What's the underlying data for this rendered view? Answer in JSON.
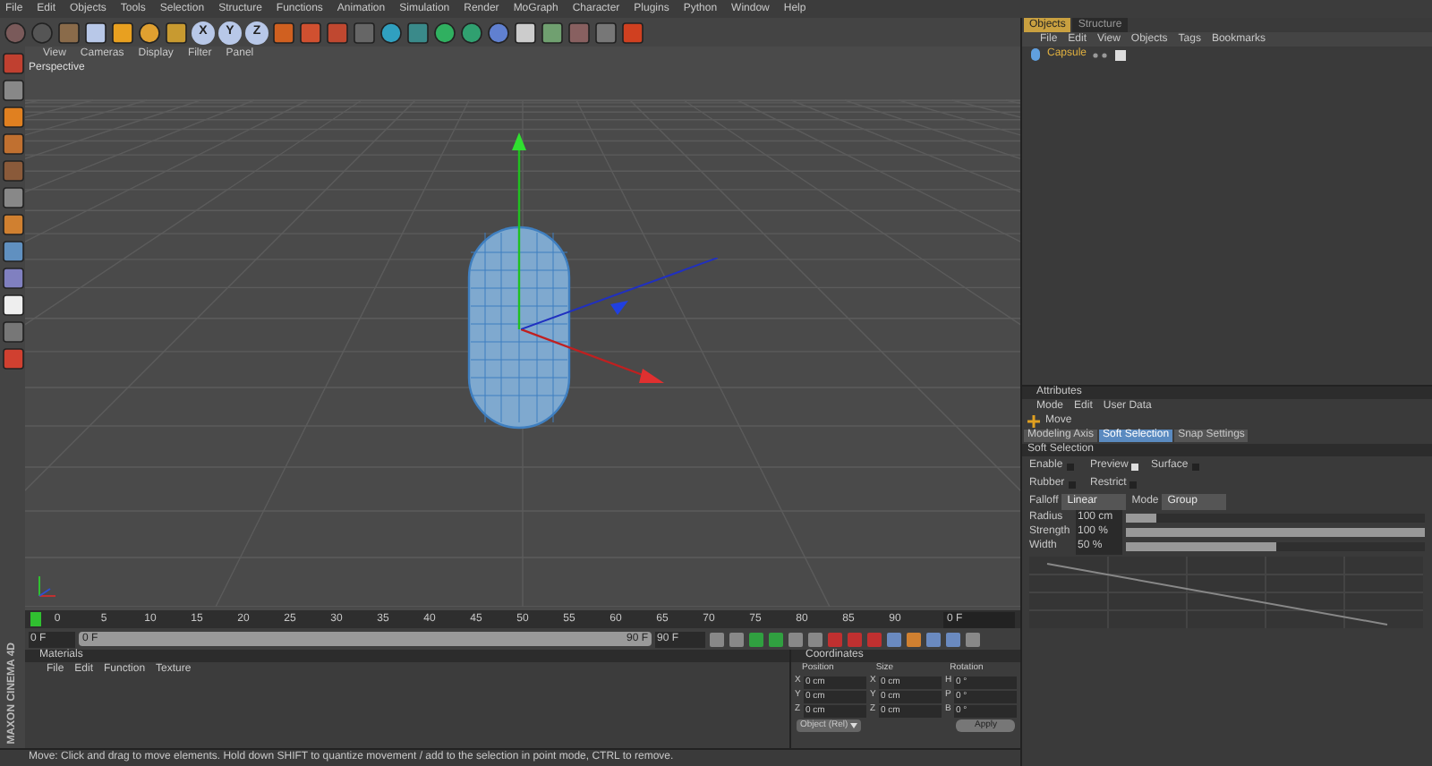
{
  "menu_bar": [
    "File",
    "Edit",
    "Objects",
    "Tools",
    "Selection",
    "Structure",
    "Functions",
    "Animation",
    "Simulation",
    "Render",
    "MoGraph",
    "Character",
    "Plugins",
    "Python",
    "Window",
    "Help"
  ],
  "toolbar": {
    "axis_buttons": [
      {
        "label": "X",
        "selected": true
      },
      {
        "label": "Y",
        "selected": true
      },
      {
        "label": "Z",
        "selected": true
      }
    ]
  },
  "viewport": {
    "menu": [
      "View",
      "Cameras",
      "Display",
      "Filter",
      "Panel"
    ],
    "camera_label": "Perspective"
  },
  "objects_panel": {
    "tabs": [
      {
        "label": "Objects",
        "selected": true
      },
      {
        "label": "Structure",
        "selected": false
      }
    ],
    "menu": [
      "File",
      "Edit",
      "View",
      "Objects",
      "Tags",
      "Bookmarks"
    ],
    "objects": [
      {
        "name": "Capsule",
        "selected": false
      }
    ]
  },
  "attributes_panel": {
    "title": "Attributes",
    "menu": [
      "Mode",
      "Edit",
      "User Data"
    ],
    "tool_name": "Move",
    "tabs": [
      {
        "label": "Modeling Axis",
        "selected": false
      },
      {
        "label": "Soft Selection",
        "selected": true
      },
      {
        "label": "Snap Settings",
        "selected": false
      }
    ],
    "section": "Soft Selection",
    "checkboxes": [
      {
        "label": "Enable",
        "checked": false
      },
      {
        "label": "Preview",
        "checked": true
      },
      {
        "label": "Surface",
        "checked": false
      },
      {
        "label": "Rubber",
        "checked": false
      },
      {
        "label": "Restrict",
        "checked": false
      }
    ],
    "dropdowns": [
      {
        "label": "Falloff",
        "value": "Linear"
      },
      {
        "label": "Mode",
        "value": "Group"
      }
    ],
    "sliders": [
      {
        "label": "Radius",
        "value": "100 cm",
        "level": 0.1
      },
      {
        "label": "Strength",
        "value": "100 %",
        "level": 1
      },
      {
        "label": "Width",
        "value": "50 %",
        "level": 0.5
      }
    ]
  },
  "timeline": {
    "ticks": [
      "0",
      "5",
      "10",
      "15",
      "20",
      "25",
      "30",
      "35",
      "40",
      "45",
      "50",
      "55",
      "60",
      "65",
      "70",
      "75",
      "80",
      "85",
      "90"
    ],
    "current_frame": "0 F",
    "playhead": {
      "level": 0
    },
    "range": {
      "level": 1
    },
    "start_field": "0 F",
    "range_start": "0 F",
    "range_end": "90 F",
    "end_field": "90 F"
  },
  "materials_panel": {
    "title": "Materials",
    "menu": [
      "File",
      "Edit",
      "Function",
      "Texture"
    ]
  },
  "coordinates_panel": {
    "title": "Coordinates",
    "columns": [
      "Position",
      "Size",
      "Rotation"
    ],
    "rows": [
      [
        {
          "axis": "X",
          "value": "0 cm"
        },
        {
          "axis": "X",
          "value": "0 cm"
        },
        {
          "axis": "H",
          "value": "0 °"
        }
      ],
      [
        {
          "axis": "Y",
          "value": "0 cm"
        },
        {
          "axis": "Y",
          "value": "0 cm"
        },
        {
          "axis": "P",
          "value": "0 °"
        }
      ],
      [
        {
          "axis": "Z",
          "value": "0 cm"
        },
        {
          "axis": "Z",
          "value": "0 cm"
        },
        {
          "axis": "B",
          "value": "0 °"
        }
      ]
    ],
    "mode_dropdown": "Object (Rel)",
    "apply_button": "Apply"
  },
  "logo": "MAXON CINEMA 4D",
  "status_bar": "Move: Click and drag to move elements. Hold down SHIFT to quantize movement / add to the selection in point mode, CTRL to remove."
}
